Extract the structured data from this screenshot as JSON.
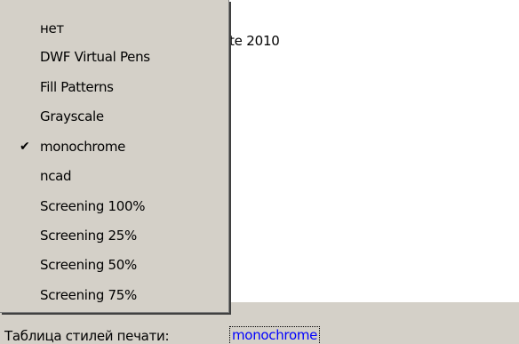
{
  "background": {
    "partial_text": "te 2010"
  },
  "dropdown": {
    "items": [
      {
        "label": "нет",
        "checked": false
      },
      {
        "label": "DWF Virtual Pens",
        "checked": false
      },
      {
        "label": "Fill Patterns",
        "checked": false
      },
      {
        "label": "Grayscale",
        "checked": false
      },
      {
        "label": "monochrome",
        "checked": true
      },
      {
        "label": "ncad",
        "checked": false
      },
      {
        "label": "Screening 100%",
        "checked": false
      },
      {
        "label": "Screening 25%",
        "checked": false
      },
      {
        "label": "Screening 50%",
        "checked": false
      },
      {
        "label": "Screening 75%",
        "checked": false
      }
    ],
    "check_glyph": "✔"
  },
  "status": {
    "label": "Таблица стилей печати:",
    "value": "monochrome"
  },
  "colors": {
    "menu_background": "#d4d0c8",
    "content_background": "#ffffff",
    "link_color": "#0000ff"
  }
}
